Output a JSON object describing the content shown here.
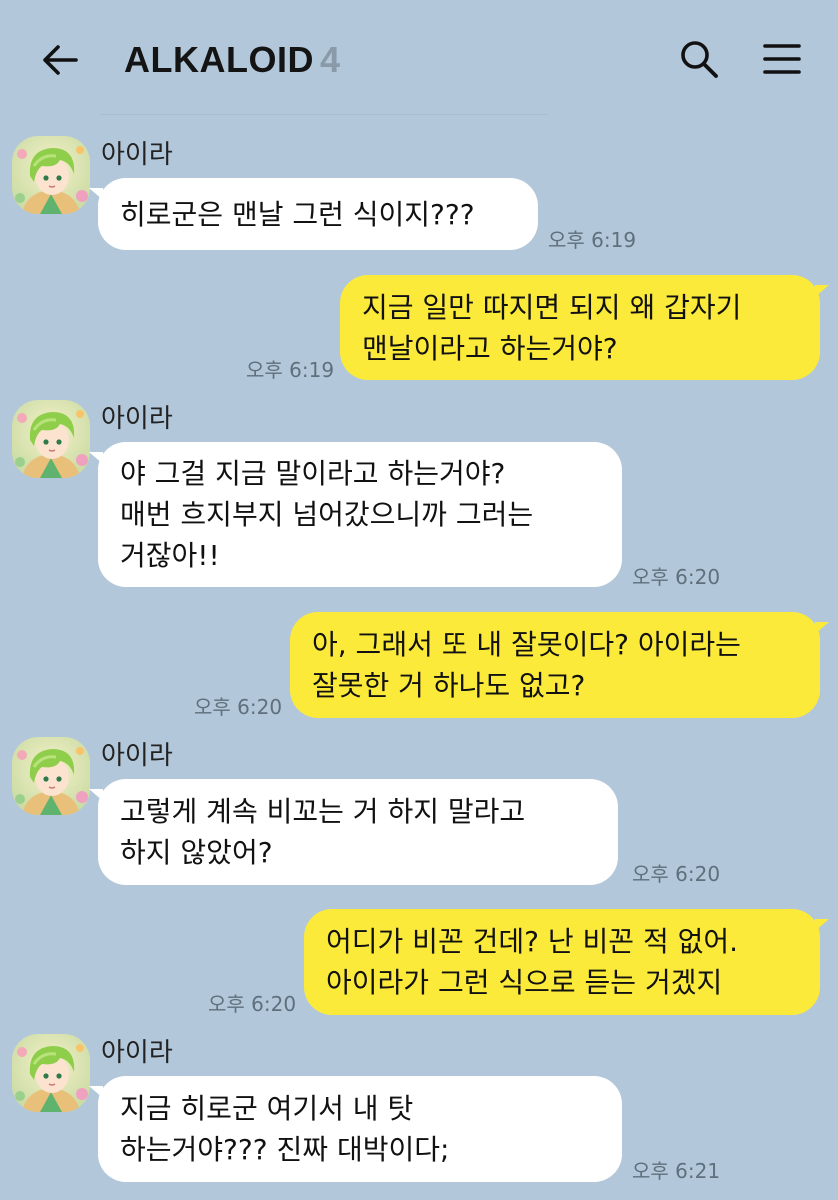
{
  "header": {
    "title": "ALKALOID",
    "member_count": "4",
    "back_icon": "arrow-left-icon",
    "search_icon": "search-icon",
    "menu_icon": "hamburger-menu-icon"
  },
  "colors": {
    "background": "#b2c7d9",
    "my_bubble": "#fcea3a",
    "their_bubble": "#ffffff",
    "timestamp": "#5f6f7c"
  },
  "messages": [
    {
      "direction": "received",
      "sender": "아이라",
      "lines": [
        "히로군은 맨날 그런 식이지???"
      ],
      "time": "오후 6:19"
    },
    {
      "direction": "sent",
      "lines": [
        "지금 일만 따지면 되지 왜 갑자기",
        "맨날이라고 하는거야?"
      ],
      "time": "오후 6:19"
    },
    {
      "direction": "received",
      "sender": "아이라",
      "lines": [
        "야 그걸 지금 말이라고 하는거야?",
        "매번 흐지부지 넘어갔으니까 그러는",
        "거잖아!!"
      ],
      "time": "오후 6:20"
    },
    {
      "direction": "sent",
      "lines": [
        "아, 그래서 또 내 잘못이다? 아이라는",
        "잘못한 거 하나도 없고?"
      ],
      "time": "오후 6:20"
    },
    {
      "direction": "received",
      "sender": "아이라",
      "lines": [
        "고렇게 계속 비꼬는 거 하지 말라고",
        "하지 않았어?"
      ],
      "time": "오후 6:20"
    },
    {
      "direction": "sent",
      "lines": [
        "어디가 비꼰 건데? 난 비꼰 적 없어.",
        "아이라가 그런 식으로 듣는   거겠지"
      ],
      "time": "오후 6:20"
    },
    {
      "direction": "received",
      "sender": "아이라",
      "lines": [
        "지금 히로군 여기서 내 탓",
        "하는거야??? 진짜 대박이다;"
      ],
      "time": "오후 6:21"
    }
  ]
}
